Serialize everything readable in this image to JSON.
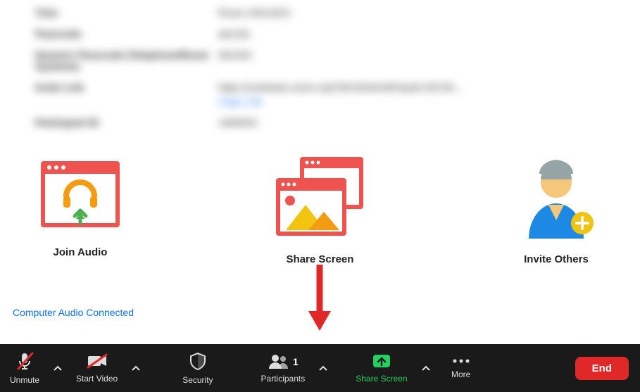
{
  "info": {
    "rows": [
      {
        "label": "Time",
        "value": "Room 24012021"
      },
      {
        "label": "Passcode",
        "value": "ab123c"
      },
      {
        "label": "Numeric Passcode (Telephone/Room Systems)",
        "value": "561034"
      },
      {
        "label": "Invite Link",
        "value": "https://us04web.zoom.us/j/78210544189?pwd=2ZC3h...",
        "link": "Copy Link"
      },
      {
        "label": "Participant ID",
        "value": "1460003"
      }
    ]
  },
  "cards": {
    "join_audio": "Join Audio",
    "share_screen": "Share Screen",
    "invite_others": "Invite Others"
  },
  "audio_status": "Computer Audio Connected",
  "toolbar": {
    "unmute": "Unmute",
    "start_video": "Start Video",
    "security": "Security",
    "participants": "Participants",
    "participants_count": "1",
    "share_screen": "Share Screen",
    "more": "More",
    "end": "End"
  }
}
